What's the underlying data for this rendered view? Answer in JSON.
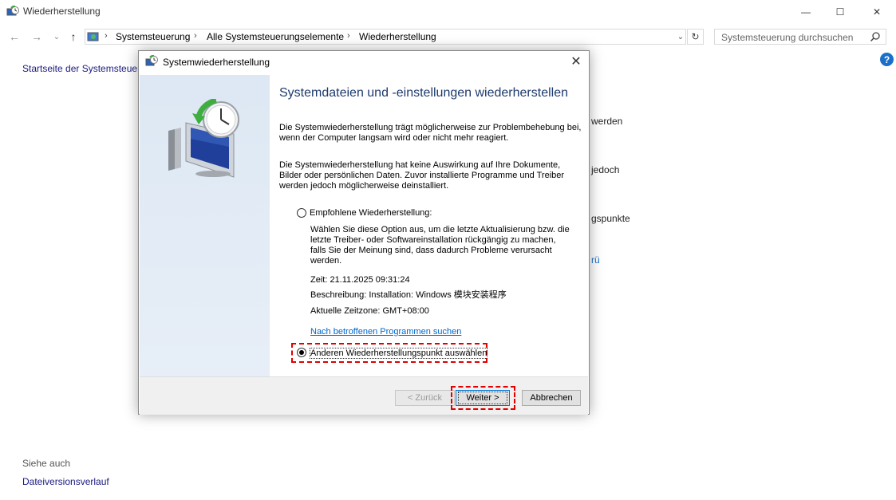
{
  "window": {
    "title": "Wiederherstellung",
    "minimize": "—",
    "maximize": "☐",
    "close": "✕"
  },
  "nav": {
    "back": "←",
    "forward": "→",
    "history": "⌄",
    "up": "↑"
  },
  "address": {
    "crumbs": [
      "Systemsteuerung",
      "Alle Systemsteuerungselemente",
      "Wiederherstellung"
    ],
    "separator": "›",
    "dropdown": "⌄",
    "refresh": "↻"
  },
  "search": {
    "placeholder": "Systemsteuerung durchsuchen"
  },
  "help": "?",
  "left_pane": {
    "home_link": "Startseite der Systemsteuerung",
    "see_also": "Siehe auch",
    "file_history": "Dateiversionsverlauf"
  },
  "background_fragments": [
    "werden",
    "jedoch",
    "gspunkte",
    "rü"
  ],
  "dialog": {
    "title": "Systemwiederherstellung",
    "close": "✕",
    "heading": "Systemdateien und -einstellungen wiederherstellen",
    "para1": "Die Systemwiederherstellung trägt möglicherweise zur Problembehebung bei, wenn der Computer langsam wird oder nicht mehr reagiert.",
    "para2": "Die Systemwiederherstellung hat keine Auswirkung auf Ihre Dokumente, Bilder oder persönlichen Daten. Zuvor installierte Programme und Treiber werden jedoch möglicherweise deinstalliert.",
    "option1": {
      "label": "Empfohlene Wiederherstellung:",
      "description": "Wählen Sie diese Option aus, um die letzte Aktualisierung bzw. die letzte Treiber- oder Softwareinstallation rückgängig zu machen, falls Sie der Meinung sind, dass dadurch Probleme verursacht werden.",
      "time": "Zeit: 21.11.2025 09:31:24",
      "description_line": "Beschreibung: Installation: Windows 模块安装程序",
      "timezone": "Aktuelle Zeitzone: GMT+08:00",
      "link": "Nach betroffenen Programmen suchen"
    },
    "option2": {
      "label": "Anderen Wiederherstellungspunkt auswählen"
    },
    "buttons": {
      "back": "< Zurück",
      "next": "Weiter >",
      "cancel": "Abbrechen"
    }
  },
  "colors": {
    "accent": "#0078d7",
    "highlight": "#e00000",
    "heading": "#1e3a6e"
  }
}
